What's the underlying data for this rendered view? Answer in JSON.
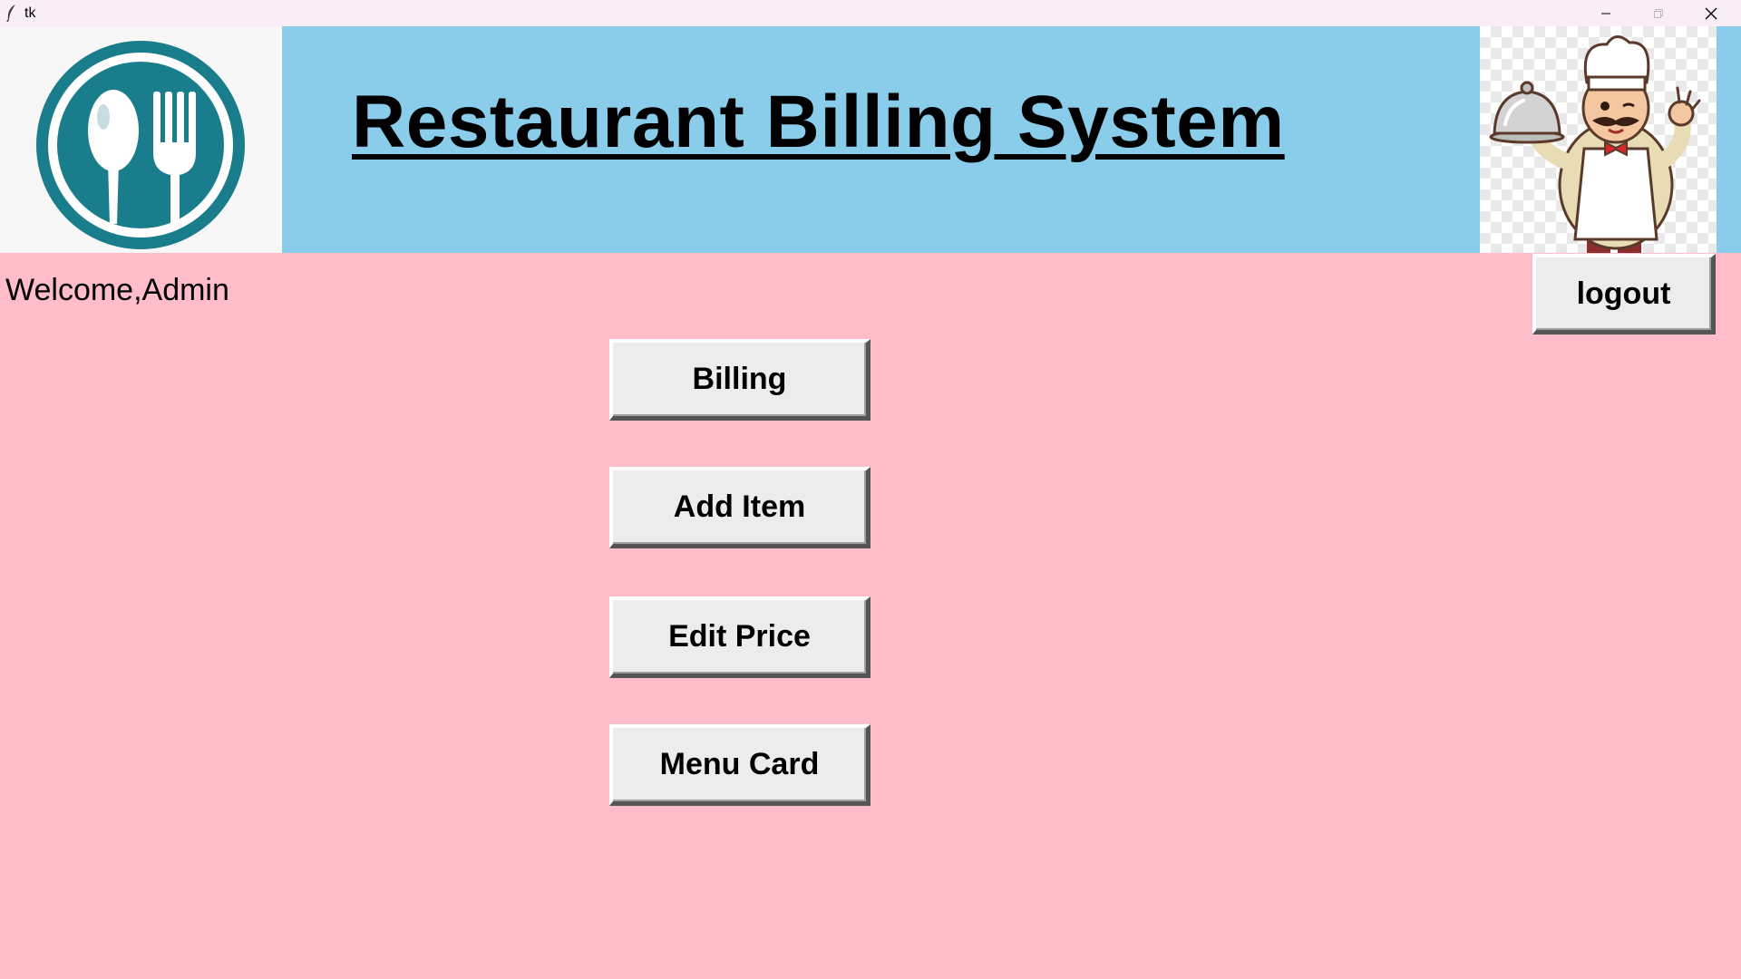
{
  "window": {
    "title": "tk"
  },
  "header": {
    "title": "Restaurant Billing System",
    "logo_icon": "plate-spoon-fork-icon",
    "mascot_icon": "chef-mascot-icon"
  },
  "user": {
    "welcome_text": "Welcome,Admin"
  },
  "actions": {
    "logout_label": "logout",
    "billing_label": "Billing",
    "add_item_label": "Add Item",
    "edit_price_label": "Edit Price",
    "menu_card_label": "Menu Card"
  },
  "colors": {
    "header_band": "#89cdea",
    "body_background": "#ffbdca",
    "logo_teal": "#1a7d8c",
    "button_face": "#ececec"
  }
}
